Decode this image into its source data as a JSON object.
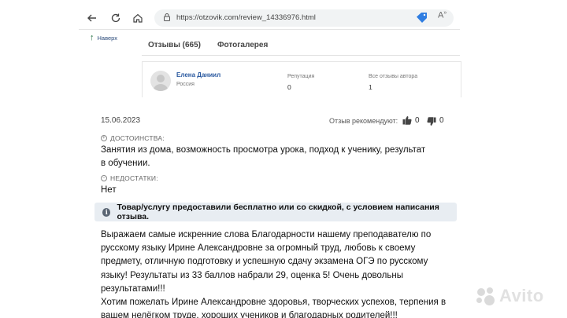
{
  "browser": {
    "url": "https://otzovik.com/review_14336976.html"
  },
  "page": {
    "back_to_top": "Наверх",
    "tabs": [
      {
        "label": "Отзывы (665)"
      },
      {
        "label": "Фотогалерея"
      }
    ]
  },
  "author": {
    "name": "Елена Даниил",
    "country": "Россия",
    "reputation_label": "Репутация",
    "reputation_value": "0",
    "all_reviews_label": "Все отзывы автора",
    "all_reviews_value": "1"
  },
  "review": {
    "date": "15.06.2023",
    "recommended_label": "Отзыв рекомендуют:",
    "likes": "0",
    "dislikes": "0",
    "pros_label": "ДОСТОИНСТВА:",
    "pros_text": "Занятия из дома, возможность просмотра урока, подход к ученику, результат в обучении.",
    "cons_label": "НЕДОСТАТКИ:",
    "cons_text": "Нет",
    "notice": "Товар/услугу предоставили бесплатно или со скидкой, с условием написания отзыва.",
    "body_p1": "Выражаем самые искренние слова Благодарности нашему преподавателю по русскому языку Ирине Александровне за огромный труд, любовь к своему предмету, отличную подготовку и успешную сдачу экзамена ОГЭ по русскому языку! Результаты из 33 баллов набрали 29, оценка 5! Очень довольны результатами!!!",
    "body_p2": "Хотим пожелать Ирине Александровне здоровья, творческих успехов, терпения в вашем нелёгком труде, хороших учеников и благодарных родителей!!!"
  },
  "watermark": {
    "text": "Avito"
  },
  "colors": {
    "link": "#2b5aa0",
    "notice_bg": "#e8edf2"
  }
}
